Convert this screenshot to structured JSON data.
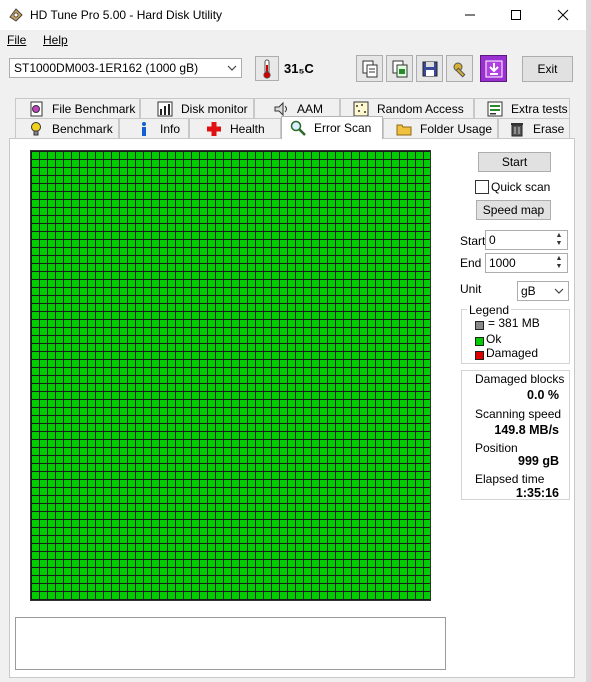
{
  "window": {
    "title": "HD Tune Pro 5.00 - Hard Disk Utility",
    "min": "—",
    "max": "☐",
    "close": "✕"
  },
  "menu": {
    "file": "File",
    "help": "Help"
  },
  "toolbar": {
    "drive": "ST1000DM003-1ER162 (1000 gB)",
    "temperature": "31₅C",
    "exit": "Exit"
  },
  "tabs_top": [
    "File Benchmark",
    "Disk monitor",
    "AAM",
    "Random Access",
    "Extra tests"
  ],
  "tabs_bottom": [
    "Benchmark",
    "Info",
    "Health",
    "Error Scan",
    "Folder Usage",
    "Erase"
  ],
  "scan": {
    "start_button": "Start",
    "quick_scan": "Quick scan",
    "speed_map": "Speed map",
    "start_label": "Start",
    "start_value": "0",
    "end_label": "End",
    "end_value": "1000",
    "unit_label": "Unit",
    "unit_value": "gB",
    "legend_title": "Legend",
    "legend_block": "= 381 MB",
    "legend_ok": "Ok",
    "legend_damaged": "Damaged",
    "damaged_blocks_label": "Damaged blocks",
    "damaged_blocks_value": "0.0 %",
    "scanning_speed_label": "Scanning speed",
    "scanning_speed_value": "149.8 MB/s",
    "position_label": "Position",
    "position_value": "999 gB",
    "elapsed_label": "Elapsed time",
    "elapsed_value": "1:35:16"
  },
  "colors": {
    "ok": "#00cc00",
    "damaged": "#e00000",
    "block": "#888888"
  }
}
